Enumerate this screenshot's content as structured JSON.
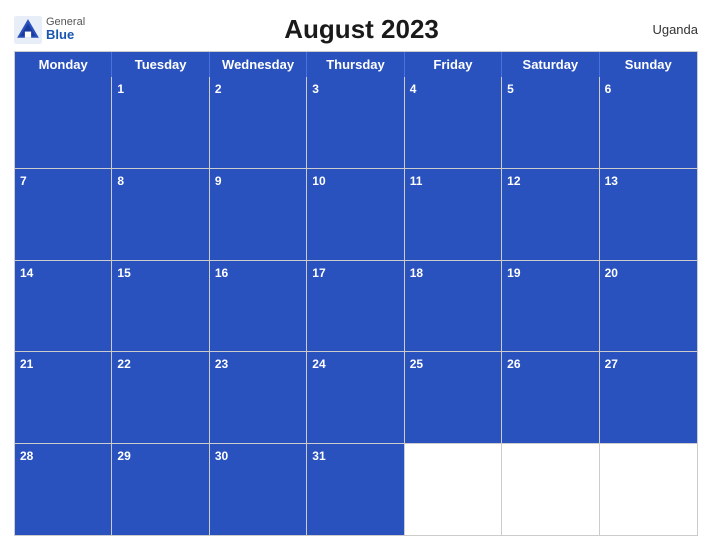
{
  "header": {
    "logo_general": "General",
    "logo_blue": "Blue",
    "title": "August 2023",
    "country": "Uganda"
  },
  "day_headers": [
    "Monday",
    "Tuesday",
    "Wednesday",
    "Thursday",
    "Friday",
    "Saturday",
    "Sunday"
  ],
  "weeks": [
    [
      {
        "num": "",
        "blue": true
      },
      {
        "num": "1",
        "blue": true
      },
      {
        "num": "2",
        "blue": true
      },
      {
        "num": "3",
        "blue": true
      },
      {
        "num": "4",
        "blue": true
      },
      {
        "num": "5",
        "blue": true
      },
      {
        "num": "6",
        "blue": true
      }
    ],
    [
      {
        "num": "7",
        "blue": true
      },
      {
        "num": "8",
        "blue": true
      },
      {
        "num": "9",
        "blue": true
      },
      {
        "num": "10",
        "blue": true
      },
      {
        "num": "11",
        "blue": true
      },
      {
        "num": "12",
        "blue": true
      },
      {
        "num": "13",
        "blue": true
      }
    ],
    [
      {
        "num": "14",
        "blue": true
      },
      {
        "num": "15",
        "blue": true
      },
      {
        "num": "16",
        "blue": true
      },
      {
        "num": "17",
        "blue": true
      },
      {
        "num": "18",
        "blue": true
      },
      {
        "num": "19",
        "blue": true
      },
      {
        "num": "20",
        "blue": true
      }
    ],
    [
      {
        "num": "21",
        "blue": true
      },
      {
        "num": "22",
        "blue": true
      },
      {
        "num": "23",
        "blue": true
      },
      {
        "num": "24",
        "blue": true
      },
      {
        "num": "25",
        "blue": true
      },
      {
        "num": "26",
        "blue": true
      },
      {
        "num": "27",
        "blue": true
      }
    ],
    [
      {
        "num": "28",
        "blue": true
      },
      {
        "num": "29",
        "blue": true
      },
      {
        "num": "30",
        "blue": true
      },
      {
        "num": "31",
        "blue": true
      },
      {
        "num": "",
        "blue": false
      },
      {
        "num": "",
        "blue": false
      },
      {
        "num": "",
        "blue": false
      }
    ]
  ]
}
